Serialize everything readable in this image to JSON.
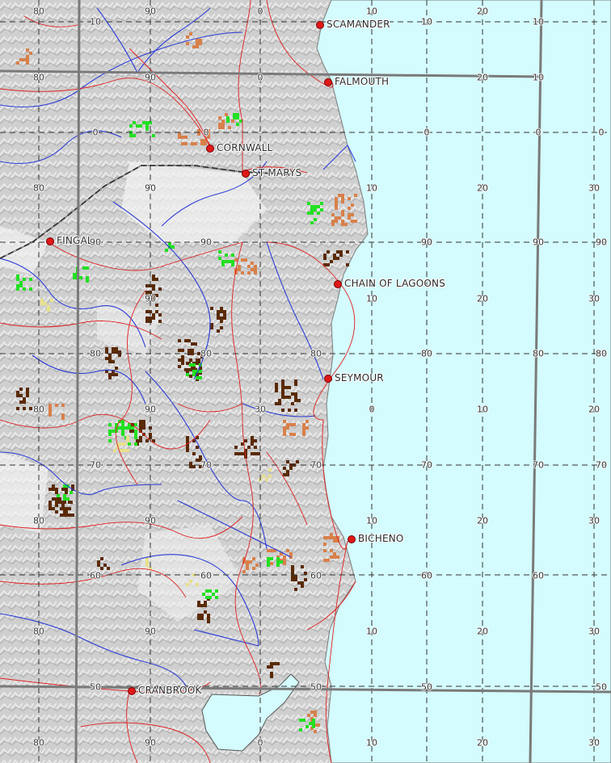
{
  "map": {
    "colors": {
      "sea": "#d4fbfd",
      "land": "#d2d2d2",
      "river": "#2b3bd6",
      "road": "#e02020",
      "highway": "#333333",
      "grid_dashed": "#333333",
      "grid_major": "#7a7a7a",
      "brown_patch": "#5a2a05",
      "orange_patch": "#d8804a",
      "green_patch": "#22e022",
      "yellow_patch": "#e8e08a"
    },
    "towns": [
      {
        "id": "scamander",
        "name": "SCAMANDER"
      },
      {
        "id": "falmouth",
        "name": "FALMOUTH"
      },
      {
        "id": "cornwall",
        "name": "CORNWALL"
      },
      {
        "id": "st-marys",
        "name": "ST MARYS"
      },
      {
        "id": "fingal",
        "name": "FINGAL"
      },
      {
        "id": "chain-of-lagoons",
        "name": "CHAIN OF LAGOONS"
      },
      {
        "id": "seymour",
        "name": "SEYMOUR"
      },
      {
        "id": "bicheno",
        "name": "BICHENO"
      },
      {
        "id": "cranbrook",
        "name": "CRANBROOK"
      }
    ],
    "grid_labels": [
      "80",
      "10",
      "90",
      "0",
      "10",
      "10",
      "20",
      "10",
      "80",
      "90",
      "0",
      "20",
      "10",
      "0",
      "0",
      "0",
      "0",
      "0",
      "80",
      "90",
      "10",
      "20",
      "30",
      "90",
      "90",
      "90",
      "90",
      "90",
      "90",
      "10",
      "20",
      "30",
      "80",
      "80",
      "80",
      "80",
      "80",
      "80",
      "80",
      "90",
      "0",
      "10",
      "20",
      "30",
      "70",
      "70",
      "70",
      "70",
      "70",
      "70",
      "80",
      "90",
      "10",
      "20",
      "30",
      "60",
      "60",
      "60",
      "60",
      "60",
      "80",
      "90",
      "10",
      "20",
      "30",
      "50",
      "50",
      "50",
      "50",
      "80",
      "90",
      "0",
      "10",
      "20",
      "30"
    ]
  }
}
